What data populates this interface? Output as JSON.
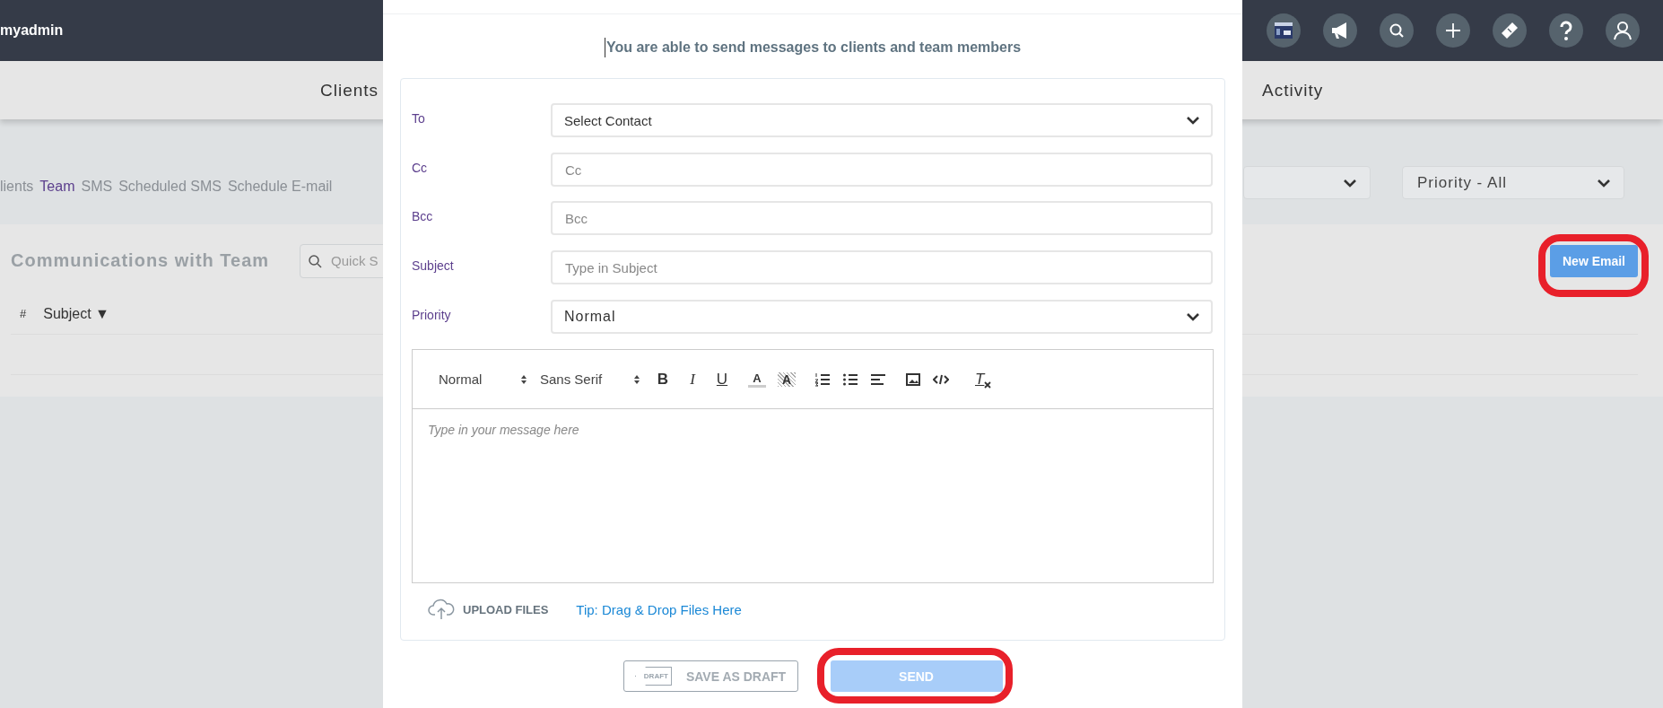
{
  "top_bar": {
    "brand": "myadmin",
    "icons": [
      {
        "kind": "window"
      },
      {
        "kind": "megaphone"
      },
      {
        "kind": "search"
      },
      {
        "kind": "plus"
      },
      {
        "kind": "ticket"
      },
      {
        "kind": "help"
      },
      {
        "kind": "user"
      }
    ]
  },
  "nav": [
    {
      "label": "Clients"
    },
    {
      "label": "Activity"
    }
  ],
  "sub_tabs": [
    {
      "label": "lients",
      "selected": false
    },
    {
      "label": "Team",
      "selected": true
    },
    {
      "label": "SMS",
      "selected": false
    },
    {
      "label": "Scheduled SMS",
      "selected": false
    },
    {
      "label": "Schedule E-mail",
      "selected": false
    }
  ],
  "filters": [
    {
      "value": "Priority - All"
    }
  ],
  "panel": {
    "title": "Communications with Team",
    "search_placeholder": "Quick S",
    "new_email_button": {
      "label": "New Email",
      "highlighted": true
    },
    "columns": [
      "#",
      "Subject ▼"
    ]
  },
  "modal": {
    "intro": "You are able to send messages to clients and team members",
    "fields": [
      {
        "label": "To",
        "kind": "select",
        "value": "Select Contact"
      },
      {
        "label": "Cc",
        "kind": "input",
        "placeholder": "Cc"
      },
      {
        "label": "Bcc",
        "kind": "input",
        "placeholder": "Bcc"
      },
      {
        "label": "Subject",
        "kind": "input",
        "placeholder": "Type in Subject"
      },
      {
        "label": "Priority",
        "kind": "select",
        "value": "Normal"
      }
    ],
    "toolbar": {
      "selects": [
        "Normal",
        "Sans Serif"
      ],
      "buttons": [
        {
          "kind": "bold",
          "label": "B"
        },
        {
          "kind": "italic",
          "label": "I"
        },
        {
          "kind": "underline",
          "label": "U"
        },
        {
          "kind": "color",
          "label": "A"
        },
        {
          "kind": "background",
          "label": "A"
        },
        {
          "kind": "ordered-list"
        },
        {
          "kind": "bullet-list"
        },
        {
          "kind": "align"
        },
        {
          "kind": "image"
        },
        {
          "kind": "code"
        },
        {
          "kind": "clean",
          "label": "T"
        }
      ]
    },
    "message_placeholder": "Type in your message here",
    "upload": {
      "label": "UPLOAD FILES",
      "tip": "Tip: Drag & Drop Files Here"
    },
    "draft_button": {
      "label": "SAVE AS DRAFT",
      "icon_text": "DRAFT"
    },
    "send_button": {
      "label": "SEND",
      "highlighted": true
    }
  }
}
